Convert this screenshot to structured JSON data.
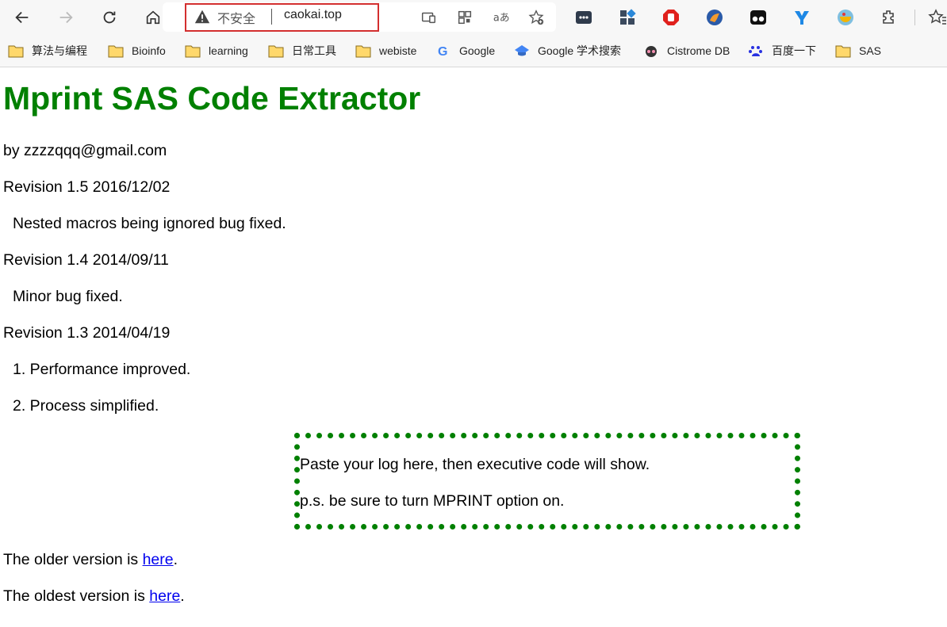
{
  "browser": {
    "security_label": "不安全",
    "url": "caokai.top",
    "accent_color": "#d32f2f"
  },
  "bookmarks": [
    {
      "label": "算法与编程",
      "icon": "folder-icon"
    },
    {
      "label": "Bioinfo",
      "icon": "folder-icon"
    },
    {
      "label": "learning",
      "icon": "folder-icon"
    },
    {
      "label": "日常工具",
      "icon": "folder-icon"
    },
    {
      "label": "webiste",
      "icon": "folder-icon"
    },
    {
      "label": "Google",
      "icon": "google-icon"
    },
    {
      "label": "Google 学术搜索",
      "icon": "scholar-icon"
    },
    {
      "label": "Cistrome DB",
      "icon": "cistrome-icon"
    },
    {
      "label": "百度一下",
      "icon": "baidu-icon"
    },
    {
      "label": "SAS",
      "icon": "folder-icon"
    }
  ],
  "page": {
    "title": "Mprint SAS Code Extractor",
    "title_color": "#008000",
    "author": "by zzzzqqq@gmail.com",
    "revisions": [
      {
        "heading": "Revision 1.5 2016/12/02",
        "notes": [
          "Nested macros being ignored bug fixed."
        ]
      },
      {
        "heading": "Revision 1.4 2014/09/11",
        "notes": [
          "Minor bug fixed."
        ]
      },
      {
        "heading": "Revision 1.3 2014/04/19",
        "notes": [
          "1. Performance improved.",
          "2. Process simplified."
        ]
      }
    ],
    "log_box": {
      "line1": "Paste your log here, then executive code will show.",
      "line2": "p.s. be sure to turn MPRINT option on.",
      "border_color": "#008000"
    },
    "older": {
      "prefix": "The older version is ",
      "link": "here",
      "suffix": "."
    },
    "oldest": {
      "prefix": "The oldest version is ",
      "link": "here",
      "suffix": "."
    }
  }
}
